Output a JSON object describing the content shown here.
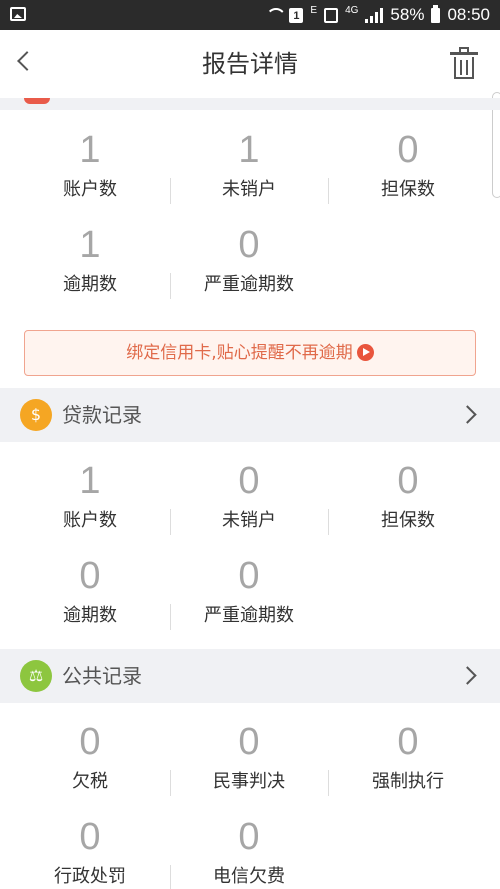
{
  "status_bar": {
    "network_1": "E",
    "network_2": "4G",
    "sim_badge": "1",
    "battery": "58%",
    "time": "08:50"
  },
  "header": {
    "title": "报告详情"
  },
  "credit_card": {
    "stats": [
      {
        "value": "1",
        "label": "账户数"
      },
      {
        "value": "1",
        "label": "未销户"
      },
      {
        "value": "0",
        "label": "担保数"
      },
      {
        "value": "1",
        "label": "逾期数"
      },
      {
        "value": "0",
        "label": "严重逾期数"
      }
    ]
  },
  "banner": {
    "text": "绑定信用卡,贴心提醒不再逾期"
  },
  "loan_records": {
    "title": "贷款记录",
    "stats": [
      {
        "value": "1",
        "label": "账户数"
      },
      {
        "value": "0",
        "label": "未销户"
      },
      {
        "value": "0",
        "label": "担保数"
      },
      {
        "value": "0",
        "label": "逾期数"
      },
      {
        "value": "0",
        "label": "严重逾期数"
      }
    ]
  },
  "public_records": {
    "title": "公共记录",
    "stats": [
      {
        "value": "0",
        "label": "欠税"
      },
      {
        "value": "0",
        "label": "民事判决"
      },
      {
        "value": "0",
        "label": "强制执行"
      },
      {
        "value": "0",
        "label": "行政处罚"
      },
      {
        "value": "0",
        "label": "电信欠费"
      }
    ]
  },
  "icons": {
    "back": "chevron-left-icon",
    "delete": "trash-icon",
    "loan": "money-bag-icon",
    "public": "scale-icon",
    "banner": "play-icon"
  },
  "colors": {
    "accent": "#e06a4a",
    "loan_icon": "#f5a623",
    "public_icon": "#8dc63f",
    "section_bg": "#f0f1f4"
  }
}
